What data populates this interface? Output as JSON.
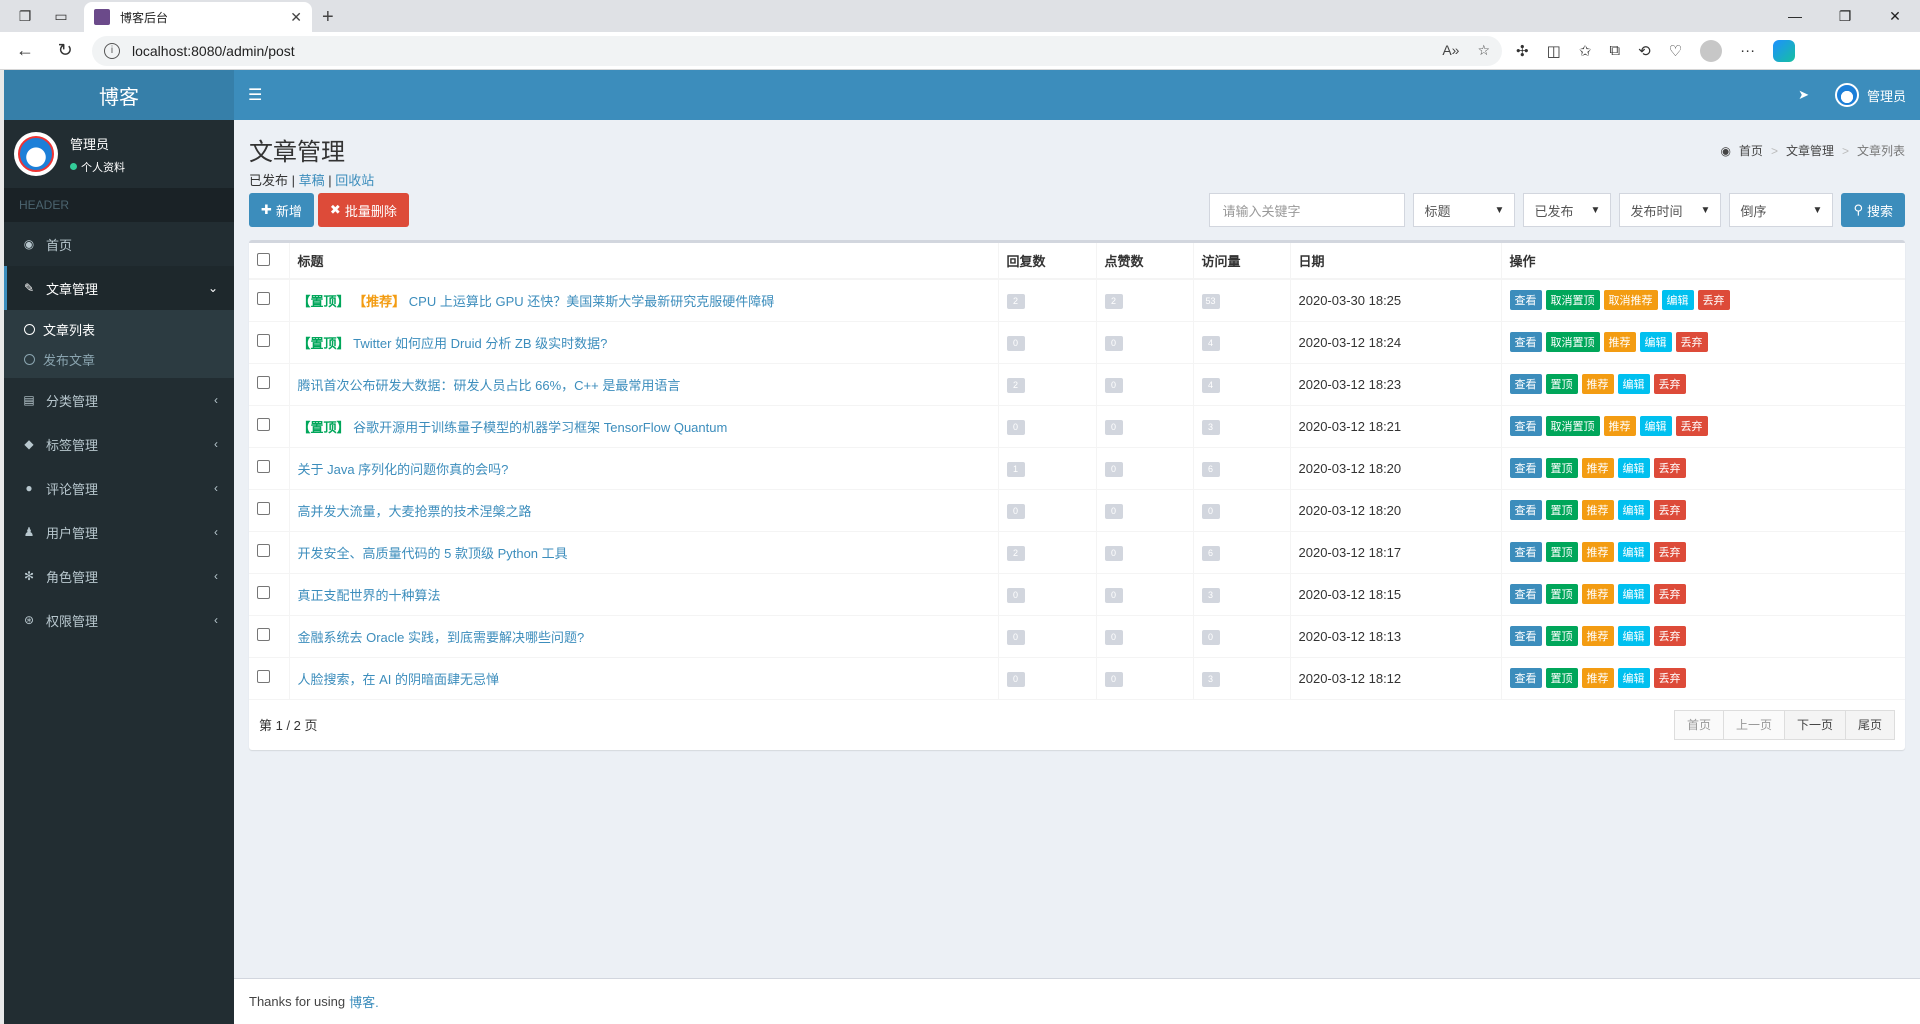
{
  "browser": {
    "tab_title": "博客后台",
    "url": "localhost:8080/admin/post"
  },
  "app": {
    "logo": "博客",
    "user": {
      "name": "管理员",
      "status": "个人资料"
    },
    "header_label": "HEADER",
    "nav_user": "管理员"
  },
  "menu": [
    {
      "label": "首页",
      "icon": "dashboard-icon"
    },
    {
      "label": "文章管理",
      "icon": "edit-icon",
      "expanded": true,
      "sub": [
        {
          "label": "文章列表",
          "active": true
        },
        {
          "label": "发布文章"
        }
      ]
    },
    {
      "label": "分类管理",
      "icon": "book-icon"
    },
    {
      "label": "标签管理",
      "icon": "tag-icon"
    },
    {
      "label": "评论管理",
      "icon": "comment-icon"
    },
    {
      "label": "用户管理",
      "icon": "user-icon"
    },
    {
      "label": "角色管理",
      "icon": "role-icon"
    },
    {
      "label": "权限管理",
      "icon": "permission-icon"
    }
  ],
  "page": {
    "title": "文章管理",
    "breadcrumb": [
      "首页",
      "文章管理",
      "文章列表"
    ],
    "status_current": "已发布",
    "status_draft": "草稿",
    "status_trash": "回收站",
    "sep": " | "
  },
  "toolbar": {
    "add": "新增",
    "batch_delete": "批量删除",
    "search_placeholder": "请输入关键字",
    "field_select": "标题",
    "status_select": "已发布",
    "sort_select": "发布时间",
    "order_select": "倒序",
    "search": "搜索"
  },
  "table": {
    "headers": [
      "标题",
      "回复数",
      "点赞数",
      "访问量",
      "日期",
      "操作"
    ],
    "tag_top": "【置顶】",
    "tag_rec": "【推荐】",
    "op_labels": {
      "view": "查看",
      "top": "置顶",
      "untop": "取消置顶",
      "rec": "推荐",
      "unrec": "取消推荐",
      "edit": "编辑",
      "del": "丢弃"
    },
    "rows": [
      {
        "top": true,
        "rec": true,
        "title": "CPU 上运算比 GPU 还快？美国莱斯大学最新研究克服硬件障碍",
        "replies": "2",
        "likes": "2",
        "views": "53",
        "date": "2020-03-30 18:25"
      },
      {
        "top": true,
        "rec": false,
        "title": "Twitter 如何应用 Druid 分析 ZB 级实时数据?",
        "replies": "0",
        "likes": "0",
        "views": "4",
        "date": "2020-03-12 18:24"
      },
      {
        "top": false,
        "rec": false,
        "title": "腾讯首次公布研发大数据：研发人员占比 66%，C++ 是最常用语言",
        "replies": "2",
        "likes": "0",
        "views": "4",
        "date": "2020-03-12 18:23"
      },
      {
        "top": true,
        "rec": false,
        "title": "谷歌开源用于训练量子模型的机器学习框架 TensorFlow Quantum",
        "replies": "0",
        "likes": "0",
        "views": "3",
        "date": "2020-03-12 18:21"
      },
      {
        "top": false,
        "rec": false,
        "title": "关于 Java 序列化的问题你真的会吗?",
        "replies": "1",
        "likes": "0",
        "views": "6",
        "date": "2020-03-12 18:20"
      },
      {
        "top": false,
        "rec": false,
        "title": "高并发大流量，大麦抢票的技术涅槃之路",
        "replies": "0",
        "likes": "0",
        "views": "0",
        "date": "2020-03-12 18:20"
      },
      {
        "top": false,
        "rec": false,
        "title": "开发安全、高质量代码的 5 款顶级 Python 工具",
        "replies": "2",
        "likes": "0",
        "views": "6",
        "date": "2020-03-12 18:17"
      },
      {
        "top": false,
        "rec": false,
        "title": "真正支配世界的十种算法",
        "replies": "0",
        "likes": "0",
        "views": "3",
        "date": "2020-03-12 18:15"
      },
      {
        "top": false,
        "rec": false,
        "title": "金融系统去 Oracle 实践，到底需要解决哪些问题?",
        "replies": "0",
        "likes": "0",
        "views": "0",
        "date": "2020-03-12 18:13"
      },
      {
        "top": false,
        "rec": false,
        "title": "人脸搜索，在 AI 的阴暗面肆无忌惮",
        "replies": "0",
        "likes": "0",
        "views": "3",
        "date": "2020-03-12 18:12"
      }
    ]
  },
  "pagination": {
    "info": "第 1 / 2 页",
    "first": "首页",
    "prev": "上一页",
    "next": "下一页",
    "last": "尾页"
  },
  "footer": {
    "text": "Thanks for using",
    "brand": "博客."
  }
}
